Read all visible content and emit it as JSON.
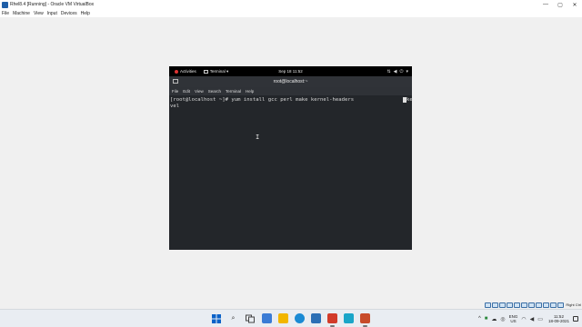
{
  "host": {
    "window_title": "Rhel8.4 [Running] - Oracle VM VirtualBox",
    "app_icon": "virtualbox-icon",
    "controls": {
      "minimize": "—",
      "maximize": "▢",
      "close": "✕"
    },
    "menu": [
      "File",
      "Machine",
      "View",
      "Input",
      "Devices",
      "Help"
    ]
  },
  "guest": {
    "topbar": {
      "activities": "Activities",
      "app_menu": "Terminal ▾",
      "clock": "Sep 18  11:52",
      "tray_icons": [
        "network-icon",
        "volume-icon",
        "power-icon"
      ]
    },
    "terminal": {
      "title": "root@localhost:~",
      "menu": [
        "File",
        "Edit",
        "View",
        "Search",
        "Terminal",
        "Help"
      ],
      "line1": "[root@localhost ~]# yum install gcc perl make kernel-headers",
      "overflow": "ke",
      "line2": "vel"
    }
  },
  "vbox_status": {
    "host_key": "Right Ctrl"
  },
  "taskbar": {
    "apps": [
      {
        "name": "start-button-icon",
        "color": "#0b62c8"
      },
      {
        "name": "search-icon",
        "color": "#333333"
      },
      {
        "name": "task-view-icon",
        "color": "#444444"
      },
      {
        "name": "widgets-icon",
        "color": "#3a7bd5"
      },
      {
        "name": "file-explorer-icon",
        "color": "#f2b600"
      },
      {
        "name": "edge-icon",
        "color": "#1a8ad4"
      },
      {
        "name": "store-icon",
        "color": "#2c6fb5"
      },
      {
        "name": "virtualbox-icon",
        "color": "#2a5d9f"
      },
      {
        "name": "red-app-icon",
        "color": "#d23b2a"
      },
      {
        "name": "teal-app-icon",
        "color": "#1aa5c8"
      },
      {
        "name": "gray-app-icon",
        "color": "#555555"
      },
      {
        "name": "vm-running-icon",
        "color": "#c84b2a"
      }
    ],
    "language": {
      "line1": "ENG",
      "line2": "US"
    },
    "time": "11:52",
    "date": "18-09-2021"
  }
}
